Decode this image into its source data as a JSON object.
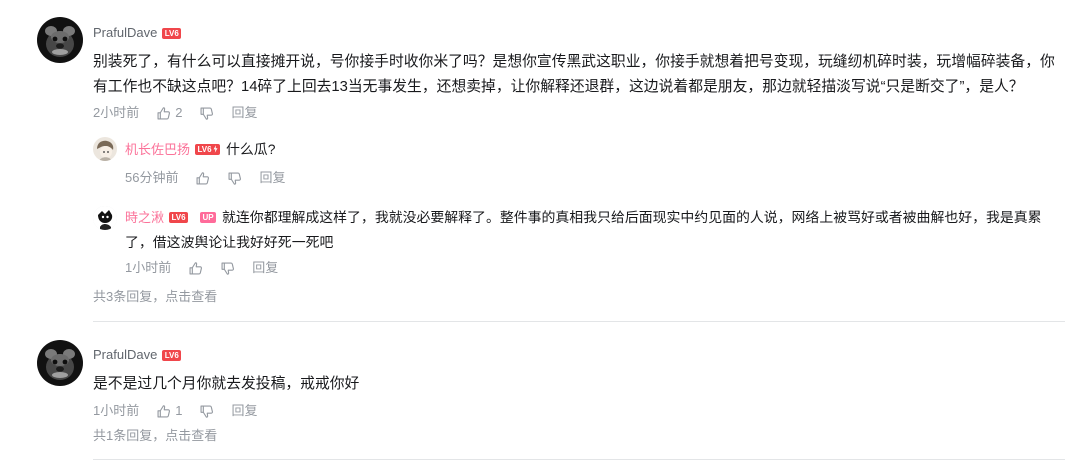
{
  "colors": {
    "text": "#18191c",
    "username": "#61666d",
    "vip_name": "#fb7299",
    "meta": "#9499a0",
    "level_badge": "#f0464b",
    "up_badge": "#ff6b9a",
    "divider": "#e3e5e7",
    "background": "#ffffff"
  },
  "icons": {
    "like": "thumbs-up-icon",
    "dislike": "thumbs-down-icon",
    "hardcore_level": "lightning-icon"
  },
  "comments": [
    {
      "user": {
        "name": "PrafulDave",
        "level": "LV6"
      },
      "content": "别装死了，有什么可以直接摊开说，号你接手时收你米了吗？是想你宣传黑武这职业，你接手就想着把号变现，玩缝纫机碎时装，玩增幅碎装备，你有工作也不缺这点吧？14碎了上回去13当无事发生，还想卖掉，让你解释还退群，这边说着都是朋友，那边就轻描淡写说“只是断交了”，是人？",
      "time": "2小时前",
      "likes": "2",
      "reply_label": "回复",
      "replies": [
        {
          "user": {
            "name": "机长佐巴扬",
            "level": "LV6"
          },
          "content": "什么瓜?",
          "time": "56分钟前",
          "reply_label": "回复"
        },
        {
          "user": {
            "name": "時之湫",
            "level": "LV6",
            "up_badge": "UP"
          },
          "content": "就连你都理解成这样了，我就没必要解释了。整件事的真相我只给后面现实中约见面的人说，网络上被骂好或者被曲解也好，我是真累了，借这波舆论让我好好死一死吧",
          "time": "1小时前",
          "reply_label": "回复"
        }
      ],
      "reply_summary": {
        "count_text": "共3条回复，",
        "action": "点击查看"
      }
    },
    {
      "user": {
        "name": "PrafulDave",
        "level": "LV6"
      },
      "content": "是不是过几个月你就去发投稿，戒戒你好",
      "time": "1小时前",
      "likes": "1",
      "reply_label": "回复",
      "reply_summary": {
        "count_text": "共1条回复，",
        "action": "点击查看"
      }
    }
  ]
}
